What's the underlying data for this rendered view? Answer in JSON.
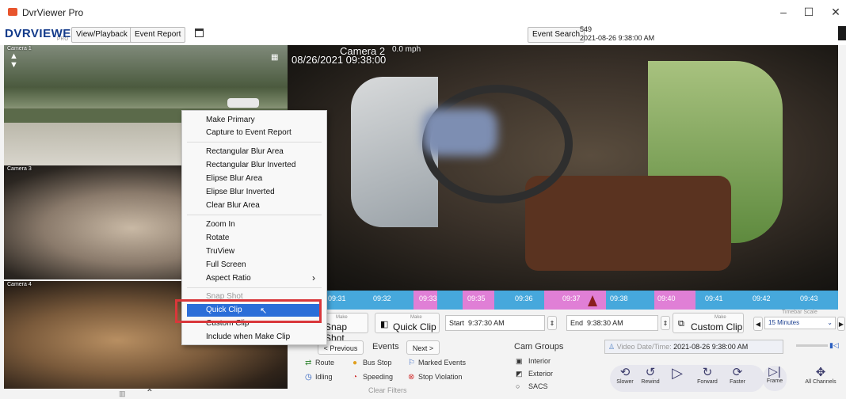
{
  "window": {
    "title": "DvrViewer Pro",
    "minimize": "–",
    "maximize": "☐",
    "close": "✕"
  },
  "toolbar": {
    "logo_main": "DVRVIEWER",
    "logo_sub": "PRO",
    "view_playback": "View/Playback",
    "event_report": "Event Report",
    "event_search": "Event Search",
    "record_count": "549",
    "datetime": "2021-08-26 9:38:00 AM"
  },
  "cameras": {
    "main_label": "Camera 2",
    "main_speed": "0.0 mph",
    "main_timestamp": "08/26/2021 09:38:00",
    "small1_label": "Camera 1",
    "small3_label": "Camera 3",
    "small4_label": "Camera 4"
  },
  "context_menu": {
    "items": [
      "Make Primary",
      "Capture to Event Report",
      "Rectangular Blur Area",
      "Rectangular Blur Inverted",
      "Elipse Blur Area",
      "Elipse Blur Inverted",
      "Clear Blur Area",
      "Zoom In",
      "Rotate",
      "TruView",
      "Full Screen",
      "Aspect Ratio",
      "Snap Shot",
      "Quick Clip",
      "Custom Clip",
      "Include when Make Clip"
    ],
    "submenu_arrow": "›"
  },
  "timeline": {
    "labels": [
      "09:31",
      "09:32",
      "09:33",
      "09:35",
      "09:36",
      "09:37",
      "09:38",
      "09:40",
      "09:41",
      "09:42",
      "09:43"
    ]
  },
  "controls": {
    "make": "Make",
    "snap_shot": "Snap Shot",
    "quick_clip": "Quick Clip",
    "start_label": "Start",
    "start_value": "9:37:30 AM",
    "end_label": "End",
    "end_value": "9:38:30 AM",
    "custom_clip": "Custom Clip",
    "timebar_scale_label": "Timebar Scale",
    "timebar_scale_value": "15 Minutes",
    "video_datetime_label": "Video Date/Time:",
    "video_datetime_value": "2021-08-26 9:38:00 AM"
  },
  "events": {
    "previous": "< Previous",
    "title": "Events",
    "next": "Next >",
    "route": "Route",
    "bus_stop": "Bus Stop",
    "marked_events": "Marked Events",
    "idling": "Idling",
    "speeding": "Speeding",
    "stop_violation": "Stop Violation",
    "clear_filters": "Clear Filters"
  },
  "cam_groups": {
    "title": "Cam Groups",
    "interior": "Interior",
    "exterior": "Exterior",
    "sacs": "SACS"
  },
  "playback": {
    "slower": "Slower",
    "rewind": "Rewind",
    "forward": "Forward",
    "faster": "Faster",
    "frame": "Frame",
    "all_channels": "All Channels"
  },
  "colors": {
    "timeline_blue": "#46a8dc",
    "timeline_pink": "#e07fd6",
    "highlight": "#2b6ed8",
    "annotation_red": "#d9373a"
  }
}
